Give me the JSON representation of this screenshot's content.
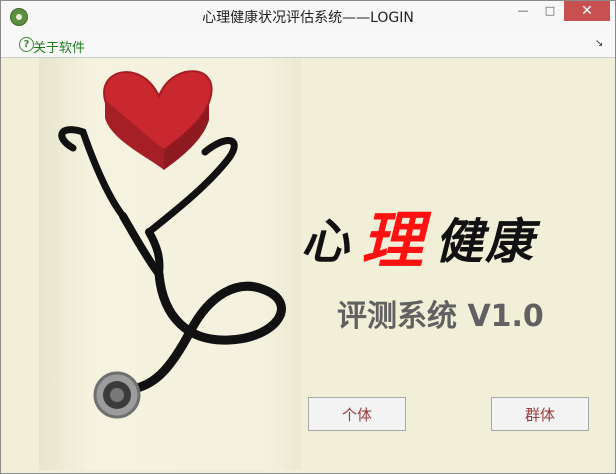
{
  "window": {
    "title": "心理健康状况评估系统——LOGIN",
    "controls": {
      "minimize": "—",
      "maximize": "□",
      "close": "✕"
    },
    "icon": "app-icon"
  },
  "menu": {
    "items": [
      {
        "label": "关于软件",
        "icon": "help-icon"
      }
    ],
    "overflow_icon": "chevron-icon"
  },
  "content": {
    "heading_parts": [
      "心",
      "理",
      "健康"
    ],
    "heading_accent_color": "#ff1111",
    "subheading": "评测系统 V1.0",
    "image": "stethoscope-heart-image"
  },
  "buttons": {
    "individual": "个体",
    "group": "群体"
  }
}
